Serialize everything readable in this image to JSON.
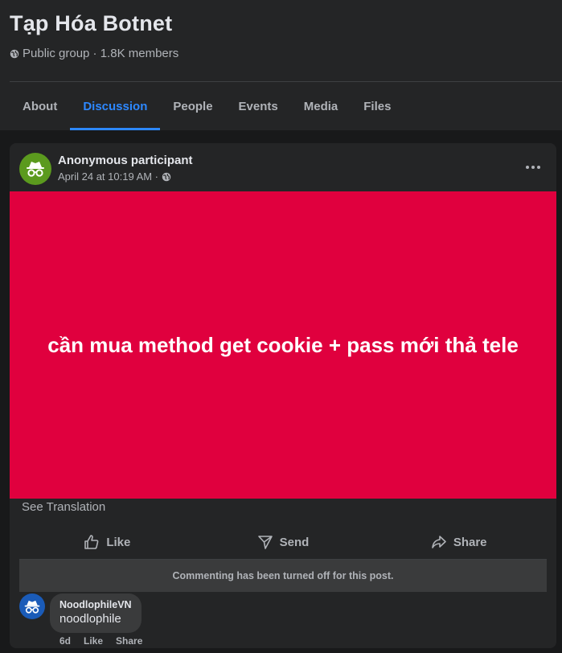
{
  "group": {
    "name": "Tạp Hóa Botnet",
    "meta": "Public group · 1.8K members"
  },
  "tabs": [
    {
      "label": "About"
    },
    {
      "label": "Discussion",
      "active": true
    },
    {
      "label": "People"
    },
    {
      "label": "Events"
    },
    {
      "label": "Media"
    },
    {
      "label": "Files"
    }
  ],
  "post": {
    "author": "Anonymous participant",
    "time": "April 24 at 10:19 AM ·",
    "banner_text": "cần mua method get cookie + pass mới thả tele",
    "banner_color": "#e0003e",
    "see_translation": "See Translation",
    "actions": {
      "like": "Like",
      "send": "Send",
      "share": "Share"
    },
    "commenting_notice": "Commenting has been turned off for this post."
  },
  "comment": {
    "author": "NoodlophileVN",
    "text": "noodlophile",
    "age": "6d",
    "like": "Like",
    "share": "Share"
  },
  "colors": {
    "accent": "#2d88ff",
    "background": "#18191a",
    "card": "#242526"
  },
  "icons": [
    "globe-icon",
    "anonymous-icon",
    "more-icon",
    "like-icon",
    "send-icon",
    "share-icon"
  ]
}
